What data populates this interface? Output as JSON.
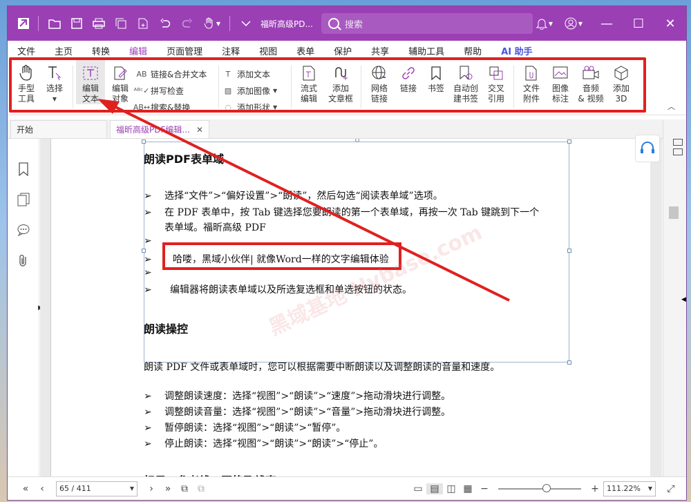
{
  "titlebar": {
    "doc_title": "福昕高级PD...",
    "search_placeholder": "搜索"
  },
  "menu": {
    "items": [
      "文件",
      "主页",
      "转换",
      "编辑",
      "页面管理",
      "注释",
      "视图",
      "表单",
      "保护",
      "共享",
      "辅助工具",
      "帮助",
      "AI 助手"
    ],
    "active": "编辑"
  },
  "ribbon": {
    "hand_tool": "手型\n工具",
    "select": "选择",
    "edit_text": "编辑\n文本",
    "edit_object": "编辑\n对象",
    "link_merge_text": "链接&合并文本",
    "spell_check": "拼写检查",
    "search_replace": "搜索&替换",
    "add_text": "添加文本",
    "add_image": "添加图像",
    "add_shape": "添加形状",
    "flow_edit": "流式\n编辑",
    "add_article": "添加\n文章框",
    "web_link": "网络\n链接",
    "link": "链接",
    "bookmark": "书签",
    "auto_bookmark": "自动创\n建书签",
    "cross_ref": "交叉\n引用",
    "file_attachment": "文件\n附件",
    "image_annotation": "图像\n标注",
    "audio_video": "音频\n& 视频",
    "add_3d": "添加\n3D"
  },
  "tabs": {
    "start": "开始",
    "doc": "福昕高级PDF编辑..."
  },
  "document": {
    "heading1": "朗读PDF表单域",
    "b1": "选择“文件”>“偏好设置”>“朗读”，然后勾选“阅读表单域”选项。",
    "b2a": "在 PDF 表单中，按 Tab 键选择您要朗读的第一个表单域，再按一次 Tab 键跳到下一个",
    "b2b": "表单域。福昕高级 PDF",
    "b4": "哈喽，黑域小伙伴| 就像Word一样的文字编辑体验",
    "b6": "编辑器将朗读表单域以及所选复选框和单选按钮的状态。",
    "heading2": "朗读操控",
    "para": "朗读 PDF 文件或表单域时，您可以根据需要中断朗读以及调整朗读的音量和速度。",
    "c1": "调整朗读速度：选择“视图”>“朗读”>“速度”>拖动滑块进行调整。",
    "c2": "调整朗读音量：选择“视图”>“朗读”>“音量”>拖动滑块进行调整。",
    "c3": "暂停朗读：选择“视图”>“朗读”>“暂停”。",
    "c4": "停止朗读：选择“视图”>“朗读”>“朗读”>“停止”。",
    "heading3": "标尺、参考线、网格及线宽",
    "bullet_glyph": "➢"
  },
  "watermark": "黑域基地 Hybase.com",
  "statusbar": {
    "page": "65 / 411",
    "zoom": "111.22%"
  },
  "colors": {
    "brand": "#9b3fb5",
    "highlight": "#e0201f"
  }
}
